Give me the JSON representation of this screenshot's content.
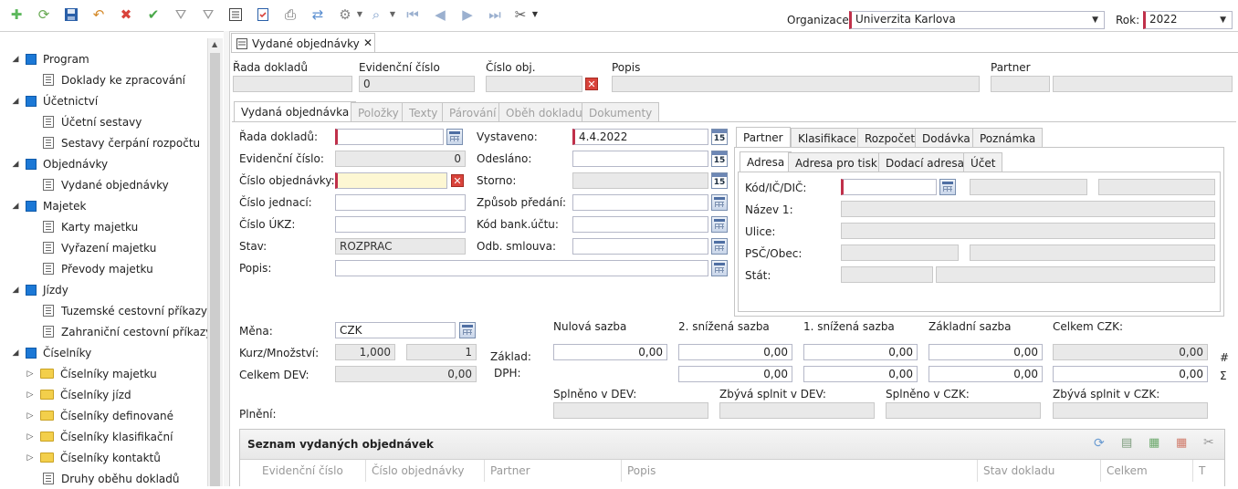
{
  "toolbar": {
    "icons": [
      "add-icon",
      "refresh-icon",
      "save-icon",
      "undo-icon",
      "delete-icon",
      "check-icon",
      "filter-icon",
      "filter-clear-icon",
      "list-icon",
      "checklist-icon",
      "print-icon",
      "sync-icon",
      "settings-icon",
      "preview-icon",
      "first-icon",
      "prev-icon",
      "next-icon",
      "last-icon",
      "tools-icon"
    ],
    "org_label": "Organizace:",
    "org_value": "Univerzita Karlova",
    "year_label": "Rok:",
    "year_value": "2022"
  },
  "sidebar": {
    "items": [
      {
        "type": "group",
        "label": "Program"
      },
      {
        "type": "doc",
        "label": "Doklady ke zpracování"
      },
      {
        "type": "group",
        "label": "Účetnictví"
      },
      {
        "type": "doc",
        "label": "Účetní sestavy"
      },
      {
        "type": "doc",
        "label": "Sestavy čerpání rozpočtu"
      },
      {
        "type": "group",
        "label": "Objednávky"
      },
      {
        "type": "doc",
        "label": "Vydané objednávky"
      },
      {
        "type": "group",
        "label": "Majetek"
      },
      {
        "type": "doc",
        "label": "Karty majetku"
      },
      {
        "type": "doc",
        "label": "Vyřazení majetku"
      },
      {
        "type": "doc",
        "label": "Převody majetku"
      },
      {
        "type": "group",
        "label": "Jízdy"
      },
      {
        "type": "doc",
        "label": "Tuzemské cestovní příkazy"
      },
      {
        "type": "doc",
        "label": "Zahraniční cestovní příkazy"
      },
      {
        "type": "group",
        "label": "Číselníky"
      },
      {
        "type": "folder",
        "label": "Číselníky majetku"
      },
      {
        "type": "folder",
        "label": "Číselníky jízd"
      },
      {
        "type": "folder",
        "label": "Číselníky definované"
      },
      {
        "type": "folder",
        "label": "Číselníky klasifikační"
      },
      {
        "type": "folder",
        "label": "Číselníky kontaktů"
      },
      {
        "type": "doc",
        "label": "Druhy oběhu dokladů"
      }
    ]
  },
  "doc_tab": {
    "label": "Vydané objednávky",
    "close": "✕"
  },
  "header": {
    "rada_label": "Řada dokladů",
    "evid_label": "Evidenční číslo",
    "evid_value": "0",
    "cislo_label": "Číslo obj.",
    "popis_label": "Popis",
    "partner_label": "Partner"
  },
  "tabs": [
    "Vydaná objednávka",
    "Položky",
    "Texty",
    "Párování",
    "Oběh dokladu",
    "Dokumenty"
  ],
  "form": {
    "rada_label": "Řada dokladů:",
    "evid_label": "Evidenční číslo:",
    "evid_value": "0",
    "cislo_label": "Číslo objednávky:",
    "jednaci_label": "Číslo jednací:",
    "ukz_label": "Číslo ÚKZ:",
    "stav_label": "Stav:",
    "stav_value": "ROZPRAC",
    "popis_label": "Popis:",
    "vystaveno_label": "Vystaveno:",
    "vystaveno_value": "4.4.2022",
    "odeslano_label": "Odesláno:",
    "storno_label": "Storno:",
    "zpusob_label": "Způsob předání:",
    "kod_bank_label": "Kód bank.účtu:",
    "smlouva_label": "Odb. smlouva:",
    "cal15": "15"
  },
  "partner_tabs": [
    "Partner",
    "Klasifikace",
    "Rozpočet",
    "Dodávka",
    "Poznámka"
  ],
  "address_tabs": [
    "Adresa",
    "Adresa pro tisk",
    "Dodací adresa",
    "Účet"
  ],
  "address": {
    "kod_label": "Kód/IČ/DIČ:",
    "nazev_label": "Název 1:",
    "ulice_label": "Ulice:",
    "psc_label": "PSČ/Obec:",
    "stat_label": "Stát:"
  },
  "money": {
    "mena_label": "Měna:",
    "mena_value": "CZK",
    "kurz_label": "Kurz/Množství:",
    "kurz_value": "1,000",
    "mnozstvi_value": "1",
    "celkem_dev_label": "Celkem DEV:",
    "celkem_dev_value": "0,00",
    "zaklad_label": "Základ:",
    "dph_label": "DPH:",
    "col_nulova": "Nulová sazba",
    "col_druha": "2. snížená sazba",
    "col_prvni": "1. snížená sazba",
    "col_zakladni": "Základní sazba",
    "col_celkem": "Celkem CZK:",
    "zero": "0,00",
    "hash": "#",
    "sigma": "Σ",
    "plneni_label": "Plnění:",
    "splneno_dev": "Splněno v DEV:",
    "zbyva_dev": "Zbývá splnit v DEV:",
    "splneno_czk": "Splněno v CZK:",
    "zbyva_czk": "Zbývá splnit v CZK:"
  },
  "grid": {
    "title": "Seznam vydaných objednávek",
    "columns": [
      "Evidenční číslo",
      "Číslo objednávky",
      "Partner",
      "Popis",
      "Stav dokladu",
      "Celkem",
      "T"
    ]
  }
}
